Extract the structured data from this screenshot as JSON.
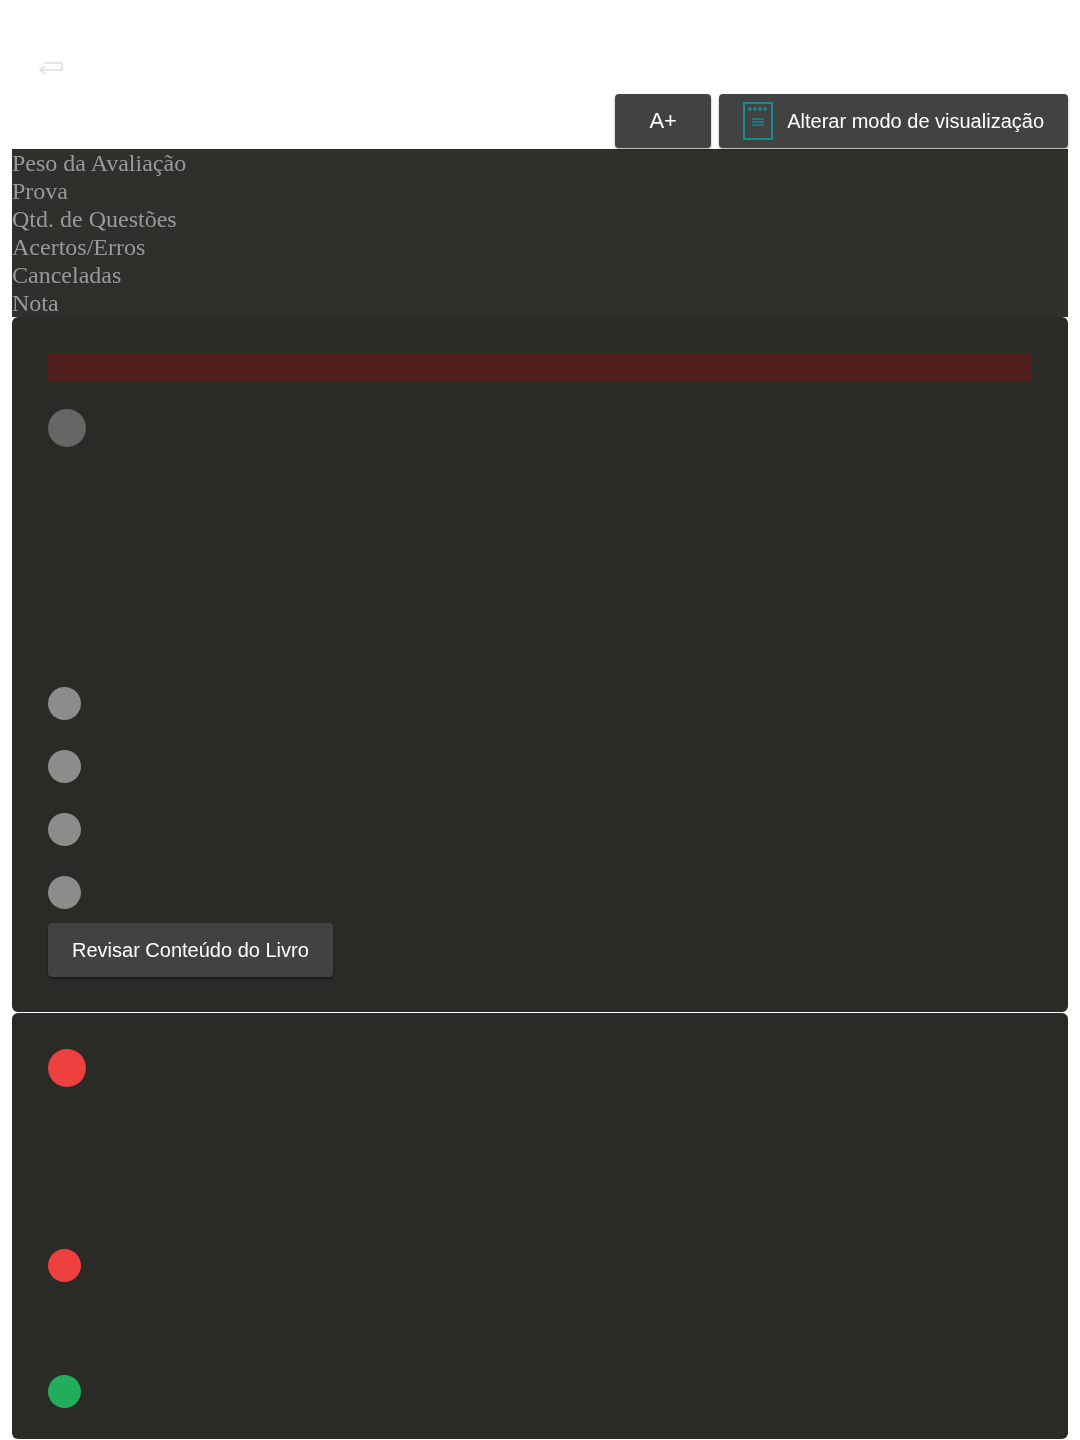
{
  "toolbar": {
    "font_button": "A+",
    "view_button": "Alterar modo de visualização"
  },
  "summary_labels": [
    "Peso da Avaliação",
    "Prova",
    "Qtd. de Questões",
    "Acertos/Erros",
    "Canceladas",
    "Nota"
  ],
  "questions": [
    {
      "banner": true,
      "color": "#666666",
      "options": [
        {
          "color": "#8c8c8c"
        },
        {
          "color": "#8c8c8c"
        },
        {
          "color": "#8c8c8c"
        },
        {
          "color": "#8c8c8c"
        }
      ],
      "review_button": "Revisar Conteúdo do Livro"
    },
    {
      "banner": false,
      "color": "#ef4040",
      "options": [
        {
          "color": "#ef4040"
        },
        {
          "color": "#22ad5c"
        }
      ]
    }
  ]
}
